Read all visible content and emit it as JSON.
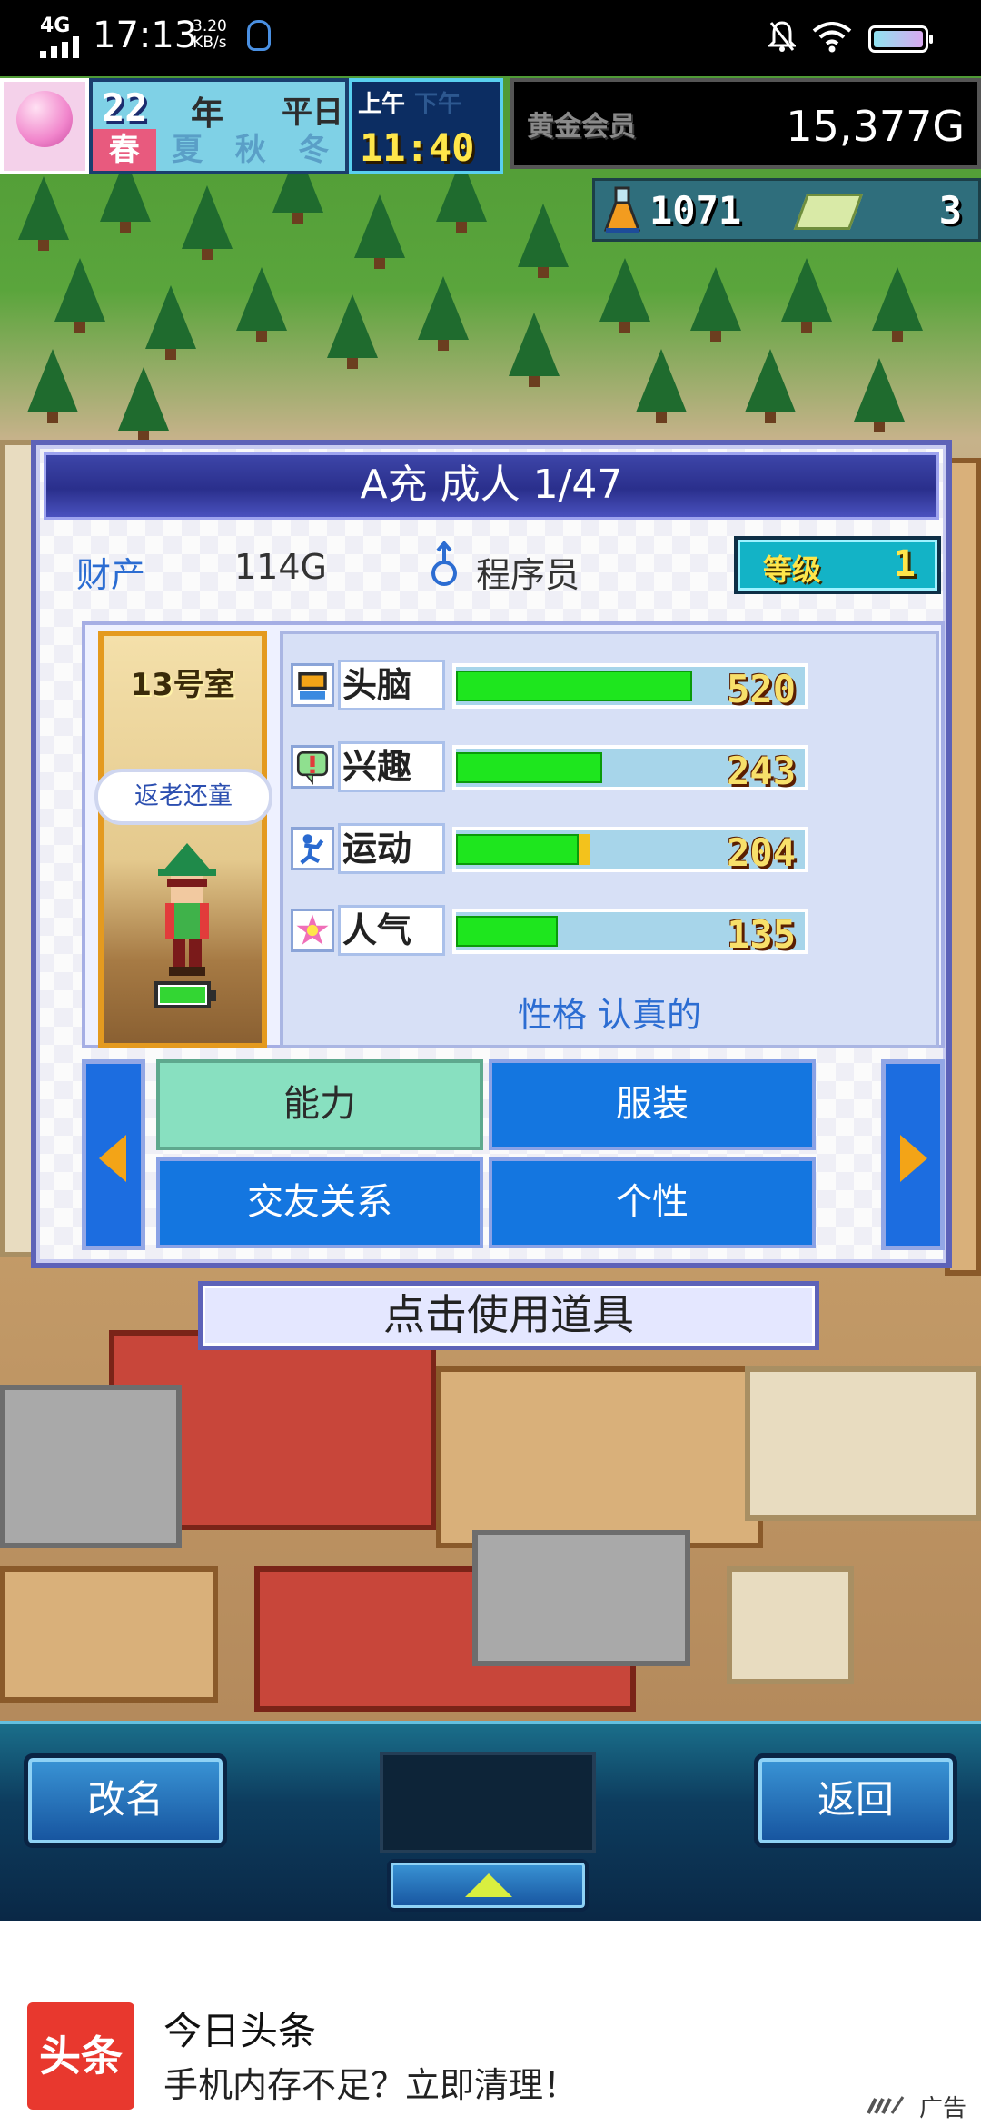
{
  "status_bar": {
    "network": "4G",
    "time": "17:13",
    "speed_value": "3.20",
    "speed_unit": "KB/s"
  },
  "hud": {
    "year_number": "22",
    "year_label": "年",
    "weekday": "平日",
    "seasons": [
      "春",
      "夏",
      "秋",
      "冬"
    ],
    "active_season": "春",
    "am_label": "上午",
    "pm_label": "下午",
    "clock": "11:40",
    "member_label": "黄金会员",
    "gold": "15,377G",
    "research_points": "1071",
    "tickets": "3"
  },
  "panel": {
    "title": "A充 成人 1/47",
    "asset_label": "财产",
    "asset_value": "114G",
    "job": "程序员",
    "level_label": "等级",
    "level_value": "1",
    "room_name": "13号室",
    "room_trait": "返老还童",
    "stats": [
      {
        "icon": "brain-icon",
        "label": "头脑",
        "value": "520",
        "fill": 1.0
      },
      {
        "icon": "interest-icon",
        "label": "兴趣",
        "value": "243",
        "fill": 0.62
      },
      {
        "icon": "sport-icon",
        "label": "运动",
        "value": "204",
        "fill": 0.52
      },
      {
        "icon": "popularity-icon",
        "label": "人气",
        "value": "135",
        "fill": 0.43
      }
    ],
    "personality": "性格 认真的",
    "tabs": {
      "ability": "能力",
      "clothing": "服装",
      "friends": "交友关系",
      "personality": "个性"
    },
    "use_item": "点击使用道具"
  },
  "bottom_bar": {
    "rename": "改名",
    "back": "返回"
  },
  "ad": {
    "logo_text": "头条",
    "title": "今日头条",
    "description": "手机内存不足？立即清理！",
    "mark": "广告"
  },
  "colors": {
    "panel_border": "#5d62b8",
    "tab_blue": "#1476e0",
    "tab_active": "#88e0c0",
    "stat_fill": "#1ee61e",
    "accent_yellow": "#ffe64a"
  }
}
